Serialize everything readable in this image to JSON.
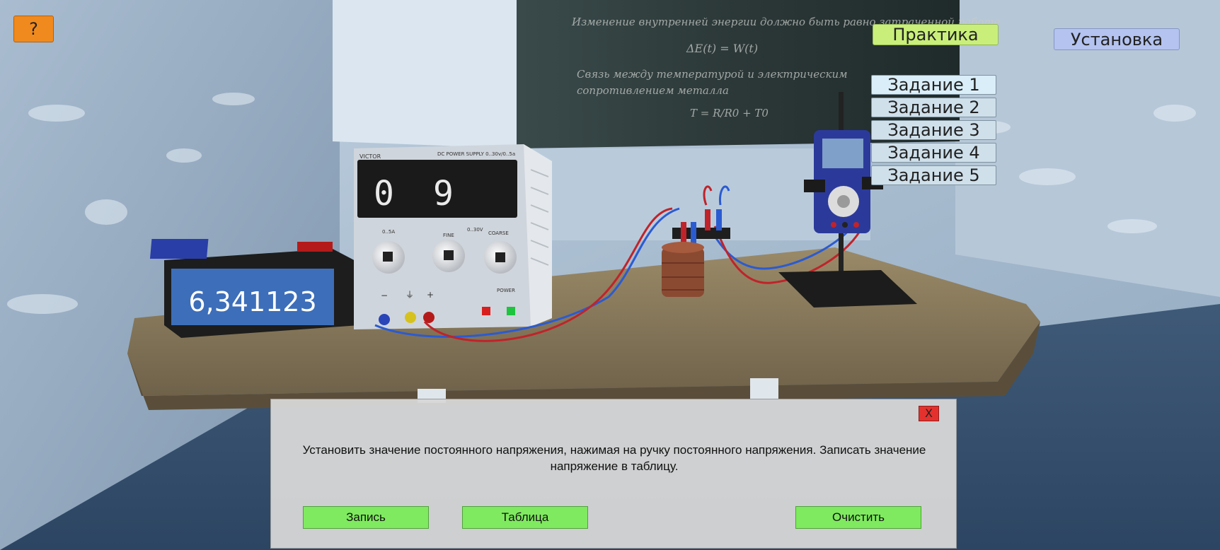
{
  "app": {
    "help_label": "?",
    "practice_label": "Практика",
    "setup_label": "Установка"
  },
  "tasks": [
    {
      "label": "Задание 1"
    },
    {
      "label": "Задание 2"
    },
    {
      "label": "Задание 3"
    },
    {
      "label": "Задание 4"
    },
    {
      "label": "Задание 5"
    }
  ],
  "equipment": {
    "meter_reading": "6,341123",
    "psu_digit_left": "0",
    "psu_digit_right": "9",
    "psu_brand": "VICTOR",
    "psu_model": "DC POWER SUPPLY 0..30v/0..5a",
    "psu_knob1": "0..5A",
    "psu_knob2": "FINE",
    "psu_knob3_range": "0..30V",
    "psu_knob3": "COARSE",
    "psu_power": "POWER",
    "psu_minus": "−",
    "psu_plus": "+"
  },
  "board": {
    "line1": "Изменение внутренней энергии должно быть равно затраченной работе",
    "formula1": "ΔE(t) = W(t)",
    "line2": "Связь между температурой и электрическим",
    "line3": "сопротивлением металла",
    "formula2": "T = R/R0 + T0"
  },
  "dialog": {
    "close_label": "X",
    "text": "Установить значение постоянного напряжения, нажимая на ручку постоянного напряжения. Записать значение напряжение в таблицу.",
    "record_label": "Запись",
    "table_label": "Таблица",
    "clear_label": "Очистить"
  }
}
